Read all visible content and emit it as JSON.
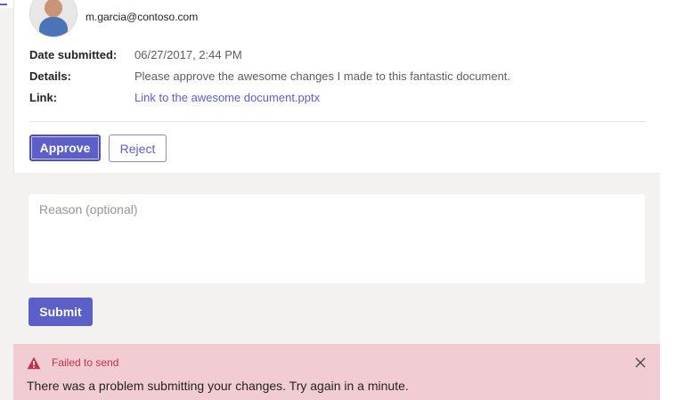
{
  "request": {
    "email": "m.garcia@contoso.com",
    "fields": [
      {
        "label": "Date submitted:",
        "value": "06/27/2017, 2:44 PM"
      },
      {
        "label": "Details:",
        "value": "Please approve the awesome changes I made to this fantastic document."
      },
      {
        "label": "Link:",
        "value": "Link to the awesome document.pptx"
      }
    ]
  },
  "actions": {
    "approve_label": "Approve",
    "reject_label": "Reject"
  },
  "form": {
    "reason_placeholder": "Reason (optional)",
    "reason_value": "",
    "submit_label": "Submit"
  },
  "error": {
    "title": "Failed to send",
    "message": "There was a problem submitting your changes. Try again in a minute.",
    "icon": "warning-icon"
  },
  "colors": {
    "accent": "#5b5fc7",
    "error_bg": "#f1ccd2",
    "error_text": "#c4314b"
  }
}
